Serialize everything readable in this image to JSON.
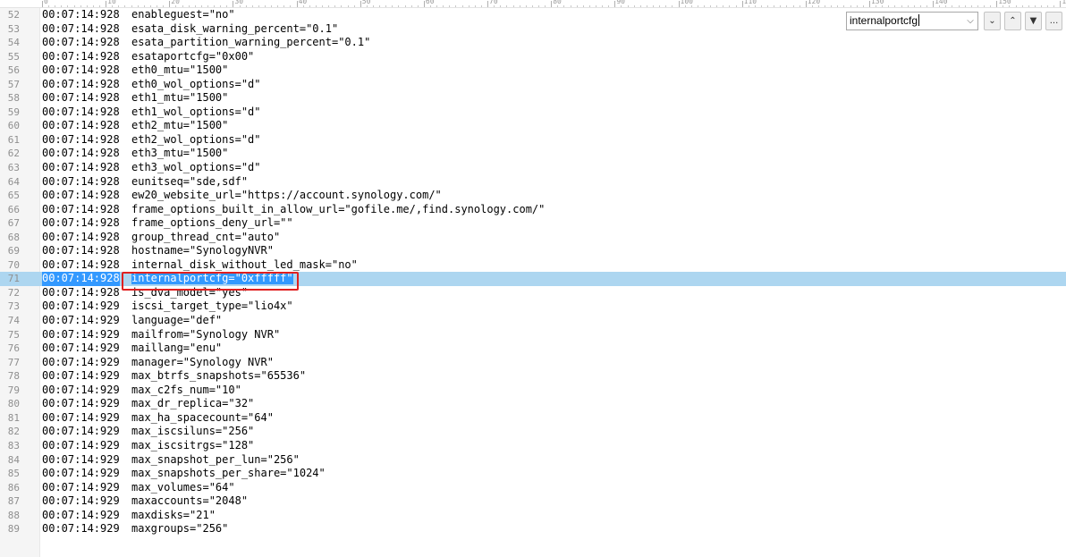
{
  "ruler": {
    "labels": [
      "0",
      "10",
      "20",
      "30",
      "40",
      "50",
      "60",
      "70",
      "80",
      "90",
      "100",
      "110",
      "120",
      "130",
      "140",
      "150",
      "160"
    ]
  },
  "find_bar": {
    "query": "internalportcfg",
    "dropdown_icon": "chevron-down-icon",
    "next_icon": "chevron-down-icon",
    "prev_icon": "chevron-up-icon",
    "filter_icon": "filter-icon",
    "more_label": "..."
  },
  "log": {
    "lines": [
      {
        "n": "52",
        "ts": "00:07:14:928",
        "text": "enableguest=\"no\""
      },
      {
        "n": "53",
        "ts": "00:07:14:928",
        "text": "esata_disk_warning_percent=\"0.1\""
      },
      {
        "n": "54",
        "ts": "00:07:14:928",
        "text": "esata_partition_warning_percent=\"0.1\""
      },
      {
        "n": "55",
        "ts": "00:07:14:928",
        "text": "esataportcfg=\"0x00\""
      },
      {
        "n": "56",
        "ts": "00:07:14:928",
        "text": "eth0_mtu=\"1500\""
      },
      {
        "n": "57",
        "ts": "00:07:14:928",
        "text": "eth0_wol_options=\"d\""
      },
      {
        "n": "58",
        "ts": "00:07:14:928",
        "text": "eth1_mtu=\"1500\""
      },
      {
        "n": "59",
        "ts": "00:07:14:928",
        "text": "eth1_wol_options=\"d\""
      },
      {
        "n": "60",
        "ts": "00:07:14:928",
        "text": "eth2_mtu=\"1500\""
      },
      {
        "n": "61",
        "ts": "00:07:14:928",
        "text": "eth2_wol_options=\"d\""
      },
      {
        "n": "62",
        "ts": "00:07:14:928",
        "text": "eth3_mtu=\"1500\""
      },
      {
        "n": "63",
        "ts": "00:07:14:928",
        "text": "eth3_wol_options=\"d\""
      },
      {
        "n": "64",
        "ts": "00:07:14:928",
        "text": "eunitseq=\"sde,sdf\""
      },
      {
        "n": "65",
        "ts": "00:07:14:928",
        "text": "ew20_website_url=\"https://account.synology.com/\""
      },
      {
        "n": "66",
        "ts": "00:07:14:928",
        "text": "frame_options_built_in_allow_url=\"gofile.me/,find.synology.com/\""
      },
      {
        "n": "67",
        "ts": "00:07:14:928",
        "text": "frame_options_deny_url=\"\""
      },
      {
        "n": "68",
        "ts": "00:07:14:928",
        "text": "group_thread_cnt=\"auto\""
      },
      {
        "n": "69",
        "ts": "00:07:14:928",
        "text": "hostname=\"SynologyNVR\""
      },
      {
        "n": "70",
        "ts": "00:07:14:928",
        "text": "internal_disk_without_led_mask=\"no\""
      },
      {
        "n": "71",
        "ts": "00:07:14:928",
        "text": "internalportcfg=\"0xfffff\"",
        "match": "internalportcfg",
        "rest": "=\"0xfffff\""
      },
      {
        "n": "72",
        "ts": "00:07:14:928",
        "text": "is_dva_model=\"yes\""
      },
      {
        "n": "73",
        "ts": "00:07:14:929",
        "text": "iscsi_target_type=\"lio4x\""
      },
      {
        "n": "74",
        "ts": "00:07:14:929",
        "text": "language=\"def\""
      },
      {
        "n": "75",
        "ts": "00:07:14:929",
        "text": "mailfrom=\"Synology NVR\""
      },
      {
        "n": "76",
        "ts": "00:07:14:929",
        "text": "maillang=\"enu\""
      },
      {
        "n": "77",
        "ts": "00:07:14:929",
        "text": "manager=\"Synology NVR\""
      },
      {
        "n": "78",
        "ts": "00:07:14:929",
        "text": "max_btrfs_snapshots=\"65536\""
      },
      {
        "n": "79",
        "ts": "00:07:14:929",
        "text": "max_c2fs_num=\"10\""
      },
      {
        "n": "80",
        "ts": "00:07:14:929",
        "text": "max_dr_replica=\"32\""
      },
      {
        "n": "81",
        "ts": "00:07:14:929",
        "text": "max_ha_spacecount=\"64\""
      },
      {
        "n": "82",
        "ts": "00:07:14:929",
        "text": "max_iscsiluns=\"256\""
      },
      {
        "n": "83",
        "ts": "00:07:14:929",
        "text": "max_iscsitrgs=\"128\""
      },
      {
        "n": "84",
        "ts": "00:07:14:929",
        "text": "max_snapshot_per_lun=\"256\""
      },
      {
        "n": "85",
        "ts": "00:07:14:929",
        "text": "max_snapshots_per_share=\"1024\""
      },
      {
        "n": "86",
        "ts": "00:07:14:929",
        "text": "max_volumes=\"64\""
      },
      {
        "n": "87",
        "ts": "00:07:14:929",
        "text": "maxaccounts=\"2048\""
      },
      {
        "n": "88",
        "ts": "00:07:14:929",
        "text": "maxdisks=\"21\""
      },
      {
        "n": "89",
        "ts": "00:07:14:929",
        "text": "maxgroups=\"256\""
      }
    ]
  },
  "colors": {
    "selection": "#3399ff",
    "current_line": "#add6f0",
    "callout": "#e02020"
  }
}
